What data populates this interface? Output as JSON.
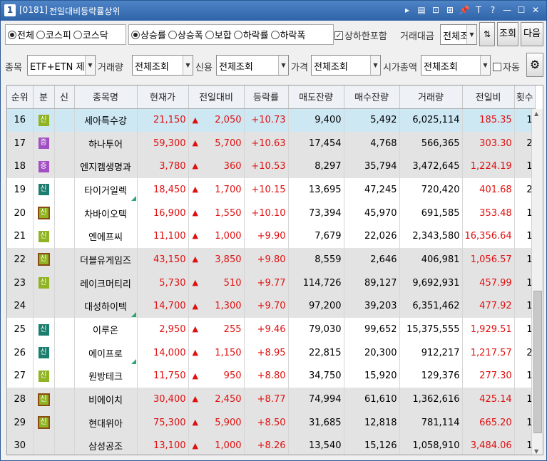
{
  "window": {
    "num": "1",
    "code": "[0181]",
    "title": "전일대비등락률상위"
  },
  "titlebar_icons": [
    "▸",
    "▤",
    "⊡",
    "⊞",
    "📌",
    "T",
    "?",
    "—",
    "☐",
    "✕"
  ],
  "filters": {
    "market": [
      {
        "label": "전체",
        "on": true
      },
      {
        "label": "코스피",
        "on": false
      },
      {
        "label": "코스닥",
        "on": false
      }
    ],
    "direction": [
      {
        "label": "상승률",
        "on": true
      },
      {
        "label": "상승폭",
        "on": false
      },
      {
        "label": "보합",
        "on": false
      },
      {
        "label": "하락률",
        "on": false
      },
      {
        "label": "하락폭",
        "on": false
      }
    ],
    "limit_label": "상하한포함",
    "limit_checked": true,
    "trade_amount_label": "거래대금",
    "trade_amount_value": "전체조",
    "query_button": "조회",
    "next_button": "다음",
    "stock_label": "종목",
    "stock_value": "ETF+ETN 제외",
    "volume_label": "거래량",
    "volume_value": "전체조회",
    "credit_label": "신용",
    "credit_value": "전체조회",
    "price_label": "가격",
    "price_value": "전체조회",
    "marketcap_label": "시가총액",
    "marketcap_value": "전체조회",
    "auto_label": "자동",
    "auto_checked": false
  },
  "columns": [
    "순위",
    "분",
    "신",
    "종목명",
    "현재가",
    "전일대비",
    "등락률",
    "매도잔량",
    "매수잔량",
    "거래량",
    "전일비",
    "횟수"
  ],
  "rows": [
    {
      "rank": "16",
      "badge": "신",
      "badge_style": "b-sin-olive",
      "name": "세아특수강",
      "price": "21,150",
      "change": "2,050",
      "rate": "+10.73",
      "ask": "9,400",
      "bid": "5,492",
      "volume": "6,025,114",
      "ratio": "185.35",
      "count": "1",
      "flag": false,
      "row": "sel"
    },
    {
      "rank": "17",
      "badge": "증",
      "badge_style": "b-jeung",
      "name": "하나투어",
      "price": "59,300",
      "change": "5,700",
      "rate": "+10.63",
      "ask": "17,454",
      "bid": "4,768",
      "volume": "566,365",
      "ratio": "303.30",
      "count": "2",
      "flag": false,
      "row": "g0"
    },
    {
      "rank": "18",
      "badge": "증",
      "badge_style": "b-jeung",
      "name": "엔지켐생명과",
      "price": "3,780",
      "change": "360",
      "rate": "+10.53",
      "ask": "8,297",
      "bid": "35,794",
      "volume": "3,472,645",
      "ratio": "1,224.19",
      "count": "1",
      "flag": false,
      "row": "g0"
    },
    {
      "rank": "19",
      "badge": "신",
      "badge_style": "b-sin-teal",
      "name": "타이거일렉",
      "price": "18,450",
      "change": "1,700",
      "rate": "+10.15",
      "ask": "13,695",
      "bid": "47,245",
      "volume": "720,420",
      "ratio": "401.68",
      "count": "2",
      "flag": true,
      "row": "g1"
    },
    {
      "rank": "20",
      "badge": "신",
      "badge_style": "b-sin-box",
      "name": "차바이오텍",
      "price": "16,900",
      "change": "1,550",
      "rate": "+10.10",
      "ask": "73,394",
      "bid": "45,970",
      "volume": "691,585",
      "ratio": "353.48",
      "count": "1",
      "flag": false,
      "row": "g1"
    },
    {
      "rank": "21",
      "badge": "신",
      "badge_style": "b-sin-olive",
      "name": "엔에프씨",
      "price": "11,100",
      "change": "1,000",
      "rate": "+9.90",
      "ask": "7,679",
      "bid": "22,026",
      "volume": "2,343,580",
      "ratio": "16,356.64",
      "count": "1",
      "flag": false,
      "row": "g1"
    },
    {
      "rank": "22",
      "badge": "신",
      "badge_style": "b-sin-box",
      "name": "더블유게임즈",
      "price": "43,150",
      "change": "3,850",
      "rate": "+9.80",
      "ask": "8,559",
      "bid": "2,646",
      "volume": "406,981",
      "ratio": "1,056.57",
      "count": "1",
      "flag": false,
      "row": "g0"
    },
    {
      "rank": "23",
      "badge": "신",
      "badge_style": "b-sin-olive",
      "name": "레이크머티리",
      "price": "5,730",
      "change": "510",
      "rate": "+9.77",
      "ask": "114,726",
      "bid": "89,127",
      "volume": "9,692,931",
      "ratio": "457.99",
      "count": "1",
      "flag": false,
      "row": "g0"
    },
    {
      "rank": "24",
      "badge": "",
      "badge_style": "",
      "name": "대성하이텍",
      "price": "14,700",
      "change": "1,300",
      "rate": "+9.70",
      "ask": "97,200",
      "bid": "39,203",
      "volume": "6,351,462",
      "ratio": "477.92",
      "count": "1",
      "flag": true,
      "row": "g0"
    },
    {
      "rank": "25",
      "badge": "신",
      "badge_style": "b-sin-teal",
      "name": "이루온",
      "price": "2,950",
      "change": "255",
      "rate": "+9.46",
      "ask": "79,030",
      "bid": "99,652",
      "volume": "15,375,555",
      "ratio": "1,929.51",
      "count": "1",
      "flag": false,
      "row": "g1"
    },
    {
      "rank": "26",
      "badge": "신",
      "badge_style": "b-sin-teal",
      "name": "에이프로",
      "price": "14,000",
      "change": "1,150",
      "rate": "+8.95",
      "ask": "22,815",
      "bid": "20,300",
      "volume": "912,217",
      "ratio": "1,217.57",
      "count": "2",
      "flag": true,
      "row": "g1"
    },
    {
      "rank": "27",
      "badge": "신",
      "badge_style": "b-sin-olive",
      "name": "원방테크",
      "price": "11,750",
      "change": "950",
      "rate": "+8.80",
      "ask": "34,750",
      "bid": "15,920",
      "volume": "129,376",
      "ratio": "277.30",
      "count": "1",
      "flag": false,
      "row": "g1"
    },
    {
      "rank": "28",
      "badge": "신",
      "badge_style": "b-sin-box",
      "name": "비에이치",
      "price": "30,400",
      "change": "2,450",
      "rate": "+8.77",
      "ask": "74,994",
      "bid": "61,610",
      "volume": "1,362,616",
      "ratio": "425.14",
      "count": "1",
      "flag": false,
      "row": "g0"
    },
    {
      "rank": "29",
      "badge": "신",
      "badge_style": "b-sin-box",
      "name": "현대위아",
      "price": "75,300",
      "change": "5,900",
      "rate": "+8.50",
      "ask": "31,685",
      "bid": "12,818",
      "volume": "781,114",
      "ratio": "665.20",
      "count": "1",
      "flag": false,
      "row": "g0"
    },
    {
      "rank": "30",
      "badge": "",
      "badge_style": "",
      "name": "삼성공조",
      "price": "13,100",
      "change": "1,000",
      "rate": "+8.26",
      "ask": "13,540",
      "bid": "15,126",
      "volume": "1,058,910",
      "ratio": "3,484.06",
      "count": "1",
      "flag": false,
      "row": "g0"
    }
  ],
  "colors": {
    "title_bar": "#3a6fb3",
    "selected_row": "#cde7f3",
    "up_red": "#e01010",
    "group_gray": "#e3e3e3"
  }
}
